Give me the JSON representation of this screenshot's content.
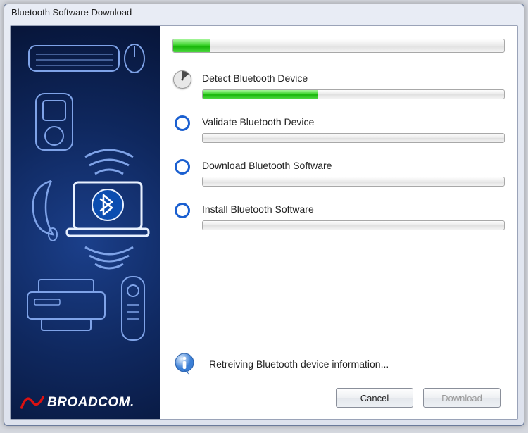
{
  "window": {
    "title": "Bluetooth Software Download"
  },
  "overall_progress_percent": 11,
  "steps": [
    {
      "label": "Detect Bluetooth Device",
      "state": "active",
      "progress_percent": 38
    },
    {
      "label": "Validate Bluetooth Device",
      "state": "pending",
      "progress_percent": 0
    },
    {
      "label": "Download Bluetooth Software",
      "state": "pending",
      "progress_percent": 0
    },
    {
      "label": "Install Bluetooth Software",
      "state": "pending",
      "progress_percent": 0
    }
  ],
  "status": {
    "message": "Retreiving Bluetooth device information..."
  },
  "buttons": {
    "cancel": "Cancel",
    "download": "Download",
    "download_enabled": false
  },
  "branding": {
    "vendor": "BROADCOM."
  }
}
